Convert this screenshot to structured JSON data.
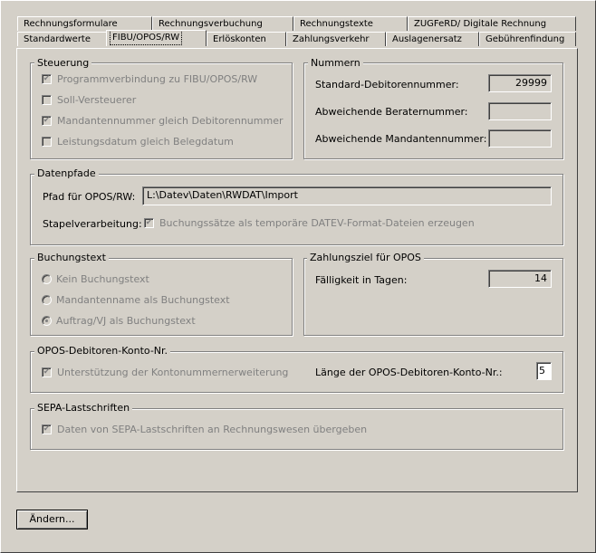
{
  "tabs": {
    "row1": [
      {
        "label": "Rechnungsformulare"
      },
      {
        "label": "Rechnungsverbuchung"
      },
      {
        "label": "Rechnungstexte"
      },
      {
        "label": "ZUGFeRD/ Digitale Rechnung"
      }
    ],
    "row2": [
      {
        "label": "Standardwerte"
      },
      {
        "label": "FIBU/OPOS/RW"
      },
      {
        "label": "Erlöskonten"
      },
      {
        "label": "Zahlungsverkehr"
      },
      {
        "label": "Auslagenersatz"
      },
      {
        "label": "Gebührenfindung"
      }
    ],
    "active": "FIBU/OPOS/RW"
  },
  "steuerung": {
    "title": "Steuerung",
    "items": [
      {
        "label": "Programmverbindung zu FIBU/OPOS/RW",
        "checked": true
      },
      {
        "label": "Soll-Versteuerer",
        "checked": false
      },
      {
        "label": "Mandantennummer gleich Debitorennummer",
        "checked": true
      },
      {
        "label": "Leistungsdatum gleich Belegdatum",
        "checked": false
      }
    ]
  },
  "nummern": {
    "title": "Nummern",
    "standard_label": "Standard-Debitorennummer:",
    "standard_value": "29999",
    "berater_label": "Abweichende Beraternummer:",
    "berater_value": "",
    "mandant_label": "Abweichende Mandantennummer:",
    "mandant_value": ""
  },
  "datenpfade": {
    "title": "Datenpfade",
    "pfad_label": "Pfad für OPOS/RW:",
    "pfad_value": "L:\\Datev\\Daten\\RWDAT\\Import",
    "stapel_label": "Stapelverarbeitung:",
    "stapel_checkbox_label": "Buchungssätze als temporäre DATEV-Format-Dateien erzeugen",
    "stapel_checked": true
  },
  "buchungstext": {
    "title": "Buchungstext",
    "options": [
      {
        "label": "Kein Buchungstext",
        "selected": false
      },
      {
        "label": "Mandantenname als Buchungstext",
        "selected": false
      },
      {
        "label": "Auftrag/VJ als Buchungstext",
        "selected": true
      }
    ]
  },
  "zahlungsziel": {
    "title": "Zahlungsziel für OPOS",
    "faelligkeit_label": "Fälligkeit in Tagen:",
    "faelligkeit_value": "14"
  },
  "opos_konto": {
    "title": "OPOS-Debitoren-Konto-Nr.",
    "checkbox_label": "Unterstützung der Kontonummernerweiterung",
    "checked": true,
    "laenge_label": "Länge der OPOS-Debitoren-Konto-Nr.:",
    "laenge_value": "5"
  },
  "sepa": {
    "title": "SEPA-Lastschriften",
    "checkbox_label": "Daten von SEPA-Lastschriften an Rechnungswesen übergeben",
    "checked": true
  },
  "footer": {
    "aendern_label": "Ändern..."
  }
}
